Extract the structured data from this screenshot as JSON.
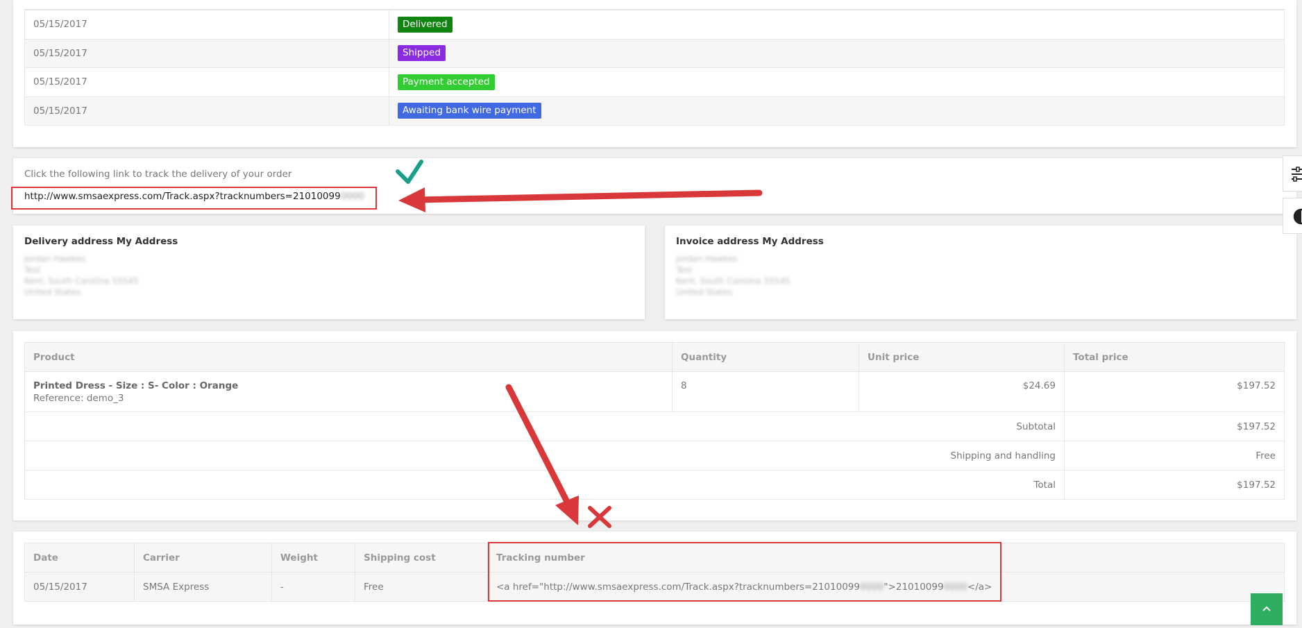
{
  "history": [
    {
      "date": "05/15/2017",
      "status": "Delivered",
      "color": "#108510"
    },
    {
      "date": "05/15/2017",
      "status": "Shipped",
      "color": "#8a2be2"
    },
    {
      "date": "05/15/2017",
      "status": "Payment accepted",
      "color": "#32cd32"
    },
    {
      "date": "05/15/2017",
      "status": "Awaiting bank wire payment",
      "color": "#4169e1"
    }
  ],
  "tracking": {
    "intro": "Click the following link to track the delivery of your order",
    "url": "http://www.smsaexpress.com/Track.aspx?tracknumbers=21010099",
    "url_hidden": "0000"
  },
  "delivery_address": {
    "title": "Delivery address My Address",
    "lines": [
      "Jordan Hawkes",
      "Test",
      "Kent, South Carolina 55545",
      "United States"
    ]
  },
  "invoice_address": {
    "title": "Invoice address My Address",
    "lines": [
      "Jordan Hawkes",
      "Test",
      "Kent, South Carolina 55545",
      "United States"
    ]
  },
  "products": {
    "headers": [
      "Product",
      "Quantity",
      "Unit price",
      "Total price"
    ],
    "item": {
      "name": "Printed Dress - Size : S- Color : Orange",
      "reference": "Reference: demo_3",
      "quantity": "8",
      "unit_price": "$24.69",
      "total_price": "$197.52"
    },
    "totals": [
      {
        "label": "Subtotal",
        "value": "$197.52"
      },
      {
        "label": "Shipping and handling",
        "value": "Free"
      },
      {
        "label": "Total",
        "value": "$197.52"
      }
    ]
  },
  "shipping": {
    "headers": [
      "Date",
      "Carrier",
      "Weight",
      "Shipping cost",
      "Tracking number"
    ],
    "row": {
      "date": "05/15/2017",
      "carrier": "SMSA Express",
      "weight": "-",
      "cost": "Free",
      "tracking_pre": "<a href=\"http://www.smsaexpress.com/Track.aspx?tracknumbers=21010099",
      "tracking_hidden1": "0000",
      "tracking_mid": "\">21010099",
      "tracking_hidden2": "0000",
      "tracking_post": "</a>"
    }
  },
  "colors": {
    "annotation_red": "#d9383a",
    "check_green": "#1a9e8a",
    "back_to_top": "#2fae60"
  },
  "icons": {
    "check": "checkmark-icon",
    "cross": "x-mark-icon",
    "settings": "sliders-icon",
    "toggle": "half-circle-icon",
    "back_to_top": "chevron-up-icon"
  }
}
